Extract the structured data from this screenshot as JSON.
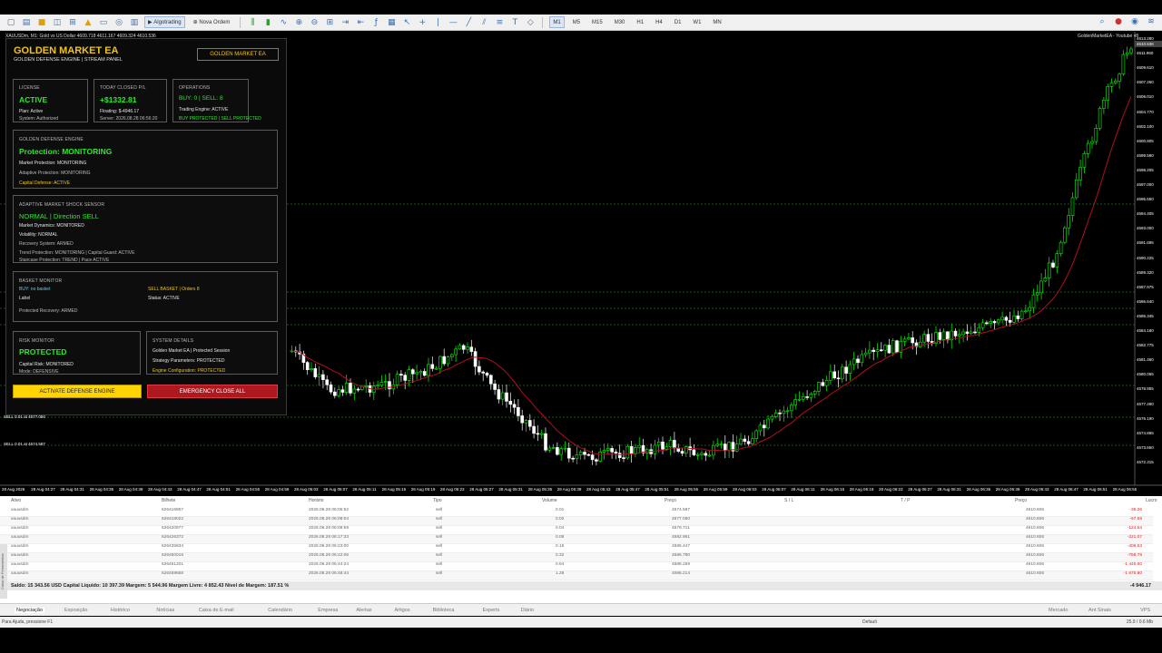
{
  "toolbar": {
    "algotrading": "Algotrading",
    "new_order": "Nova Ordem",
    "timeframes": [
      "M1",
      "M5",
      "M15",
      "M30",
      "H1",
      "H4",
      "D1",
      "W1",
      "MN"
    ],
    "active_tf": "M1"
  },
  "chart": {
    "header": "XAUUSDm, M1: Gold vs US Dollar 4609.718 4611.167 4609.324 4610.536",
    "indicator": "GoldenMarketEA - Youtube v8",
    "sell_lines": [
      "SELL 0.01 at 4577.050",
      "SELL 0.01 at 4574.587"
    ],
    "prices": [
      "4613.280",
      "4611.950",
      "4609.610",
      "4607.260",
      "4606.010",
      "4604.770",
      "4602.100",
      "4600.805",
      "4599.590",
      "4598.205",
      "4597.000",
      "4595.650",
      "4594.405",
      "4593.000",
      "4591.695",
      "4590.225",
      "4589.320",
      "4587.975",
      "4586.640",
      "4585.345",
      "4584.180",
      "4582.775",
      "4581.460",
      "4580.055",
      "4578.955",
      "4577.490",
      "4576.190",
      "4574.865",
      "4573.650",
      "4572.315"
    ],
    "current_price": "4610.536",
    "times": [
      "28 Aug 2026",
      "28 Aug 04:27",
      "28 Aug 04:31",
      "28 Aug 04:35",
      "28 Aug 04:39",
      "28 Aug 04:43",
      "28 Aug 04:47",
      "28 Aug 04:51",
      "28 Aug 04:55",
      "28 Aug 04:59",
      "28 Aug 05:03",
      "28 Aug 05:07",
      "28 Aug 05:11",
      "28 Aug 05:15",
      "28 Aug 05:19",
      "28 Aug 05:23",
      "28 Aug 05:27",
      "28 Aug 05:31",
      "28 Aug 05:35",
      "28 Aug 05:39",
      "28 Aug 05:43",
      "28 Aug 05:47",
      "28 Aug 05:51",
      "28 Aug 05:55",
      "28 Aug 05:59",
      "28 Aug 06:03",
      "28 Aug 06:07",
      "28 Aug 06:11",
      "28 Aug 06:15",
      "28 Aug 06:19",
      "28 Aug 06:23",
      "28 Aug 06:27",
      "28 Aug 06:31",
      "28 Aug 06:35",
      "28 Aug 06:39",
      "28 Aug 06:43",
      "28 Aug 06:47",
      "28 Aug 06:51",
      "28 Aug 06:55"
    ],
    "colors": {
      "bull": "#00ff00",
      "bear": "#ffffff",
      "ma": "#b01020",
      "level": "#2ea82e"
    }
  },
  "panel": {
    "title": "GOLDEN MARKET EA",
    "subtitle": "GOLDEN DEFENSE ENGINE | STREAM PANEL",
    "badge": "GOLDEN MARKET EA",
    "license": {
      "cap": "LICENSE",
      "status": "ACTIVE",
      "l1": "Plan: Active",
      "l2": "System: Authorized"
    },
    "pnl": {
      "cap": "TODAY CLOSED P/L",
      "value": "+$1332.81",
      "l1": "Floating: $-4946.17",
      "l2": "Server: 2026.08.28 06:56:20"
    },
    "ops": {
      "cap": "OPERATIONS",
      "value": "BUY: 0 | SELL: 8",
      "l1": "Trading Engine: ACTIVE",
      "l2": "BUY PROTECTED | SELL PROTECTED"
    },
    "defense": {
      "cap": "GOLDEN DEFENSE ENGINE",
      "status": "Protection: MONITORING",
      "l1": "Market Protection: MONITORING",
      "l2": "Adaptive Protection: MONITORING",
      "l3": "Capital Defense: ACTIVE"
    },
    "shock": {
      "cap": "ADAPTIVE MARKET SHOCK SENSOR",
      "status": "NORMAL | Direction SELL",
      "l1": "Market Dynamics: MONITORED",
      "l2": "Volatility: NORMAL",
      "l3": "Recovery System: ARMED",
      "l4": "Trend Protection: MONITORING | Capital Guard: ACTIVE",
      "l5": "Staircase Protection: TREND | Pace ACTIVE"
    },
    "basket": {
      "cap": "BASKET MONITOR",
      "buy": "BUY: no basket",
      "sell": "SELL BASKET | Orders 8",
      "label": "Label",
      "status": "Status: ACTIVE",
      "recovery": "Protected Recovery: ARMED"
    },
    "risk": {
      "cap": "RISK MONITOR",
      "status": "PROTECTED",
      "l1": "Capital Risk: MONITORED",
      "l2": "Mode: DEFENSIVE"
    },
    "system": {
      "cap": "SYSTEM DETAILS",
      "l1": "Golden Market EA | Protected Session",
      "l2": "Strategy Parameters: PROTECTED",
      "l3": "Engine Configuration: PROTECTED"
    },
    "btn_activate": "ACTIVATE DEFENSE ENGINE",
    "btn_close": "EMERGENCY CLOSE ALL"
  },
  "terminal": {
    "headers": [
      "Ativo",
      "Bilhete",
      "Horário",
      "Tipo",
      "Volume",
      "Preço",
      "S / L",
      "T / P",
      "Preço",
      "Lucro"
    ],
    "rows": [
      [
        "xauusdm",
        "626416957",
        "2026.08.28 06:05:52",
        "sell",
        "0.01",
        "4574.587",
        "",
        "",
        "4610.606",
        "-36.26"
      ],
      [
        "xauusdm",
        "626418022",
        "2026.08.28 06:08:04",
        "sell",
        "0.02",
        "4577.050",
        "",
        "",
        "4610.606",
        "-67.59"
      ],
      [
        "xauusdm",
        "626420977",
        "2026.08.28 06:09:59",
        "sell",
        "0.04",
        "4579.711",
        "",
        "",
        "4610.606",
        "-124.54"
      ],
      [
        "xauusdm",
        "626426372",
        "2026.08.28 06:17:33",
        "sell",
        "0.08",
        "4582.961",
        "",
        "",
        "4610.606",
        "-221.07"
      ],
      [
        "xauusdm",
        "626435834",
        "2026.08.28 06:23:00",
        "sell",
        "0.16",
        "4585.447",
        "",
        "",
        "4610.606",
        "-406.53"
      ],
      [
        "xauusdm",
        "626450016",
        "2026.08.28 06:42:06",
        "sell",
        "0.32",
        "4586.790",
        "",
        "",
        "4610.606",
        "-768.79"
      ],
      [
        "xauusdm",
        "626451201",
        "2026.08.28 06:44:24",
        "sell",
        "0.64",
        "4588.259",
        "",
        "",
        "4610.606",
        "-1 445.60"
      ],
      [
        "xauusdm",
        "626459658",
        "2026.08.28 06:48:44",
        "sell",
        "1.28",
        "4596.214",
        "",
        "",
        "4610.606",
        "-1 875.80"
      ]
    ],
    "balance": "Saldo: 15 343.56 USD  Capital Líquido: 10 397.39  Margem: 5 544.96  Margem Livre: 4 852.43  Nível de Margem: 187.51 %",
    "total": "-4 946.17"
  },
  "tabs": [
    "Negociação",
    "Exposição",
    "Histórico",
    "Notícias",
    "Caixa de E-mail",
    "Calendário",
    "Empresa",
    "Alertas",
    "Artigos",
    "Biblioteca",
    "Experts",
    "Diário"
  ],
  "tabs_right": [
    "Mercado",
    "Ant Sinais",
    "VPS",
    "Testador"
  ],
  "status": {
    "help": "Para Ajuda, pressione F1",
    "profile": "Default",
    "traffic": "25.9 / 0.6 Mb"
  },
  "side_label": "Caixa de Ferramentas"
}
